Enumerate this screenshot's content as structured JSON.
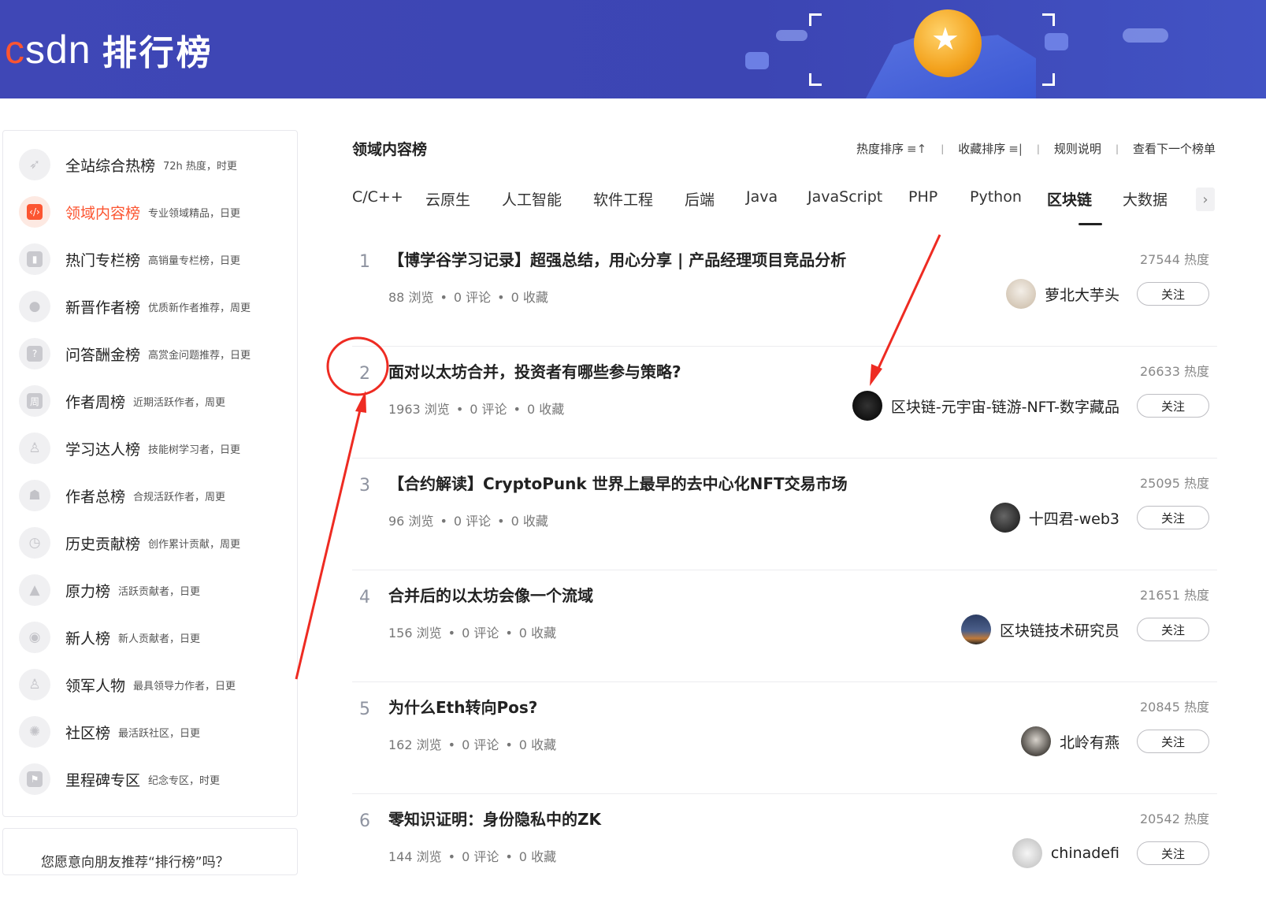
{
  "brand": {
    "logo_text": "csdn",
    "title": "排行榜"
  },
  "sidebar": {
    "items": [
      {
        "name": "全站综合热榜",
        "desc": "72h 热度，时更",
        "icon": "rocket-icon",
        "active": false
      },
      {
        "name": "领域内容榜",
        "desc": "专业领域精品，日更",
        "icon": "code-icon",
        "active": true
      },
      {
        "name": "热门专栏榜",
        "desc": "高销量专栏榜，日更",
        "icon": "bookmark-icon",
        "active": false
      },
      {
        "name": "新晋作者榜",
        "desc": "优质新作者推荐，周更",
        "icon": "user-icon",
        "active": false
      },
      {
        "name": "问答酬金榜",
        "desc": "高赏金问题推荐，日更",
        "icon": "question-icon",
        "active": false
      },
      {
        "name": "作者周榜",
        "desc": "近期活跃作者，周更",
        "icon": "week-icon",
        "active": false
      },
      {
        "name": "学习达人榜",
        "desc": "技能树学习者，日更",
        "icon": "medal-icon",
        "active": false
      },
      {
        "name": "作者总榜",
        "desc": "合规活跃作者，周更",
        "icon": "group-icon",
        "active": false
      },
      {
        "name": "历史贡献榜",
        "desc": "创作累计贡献，周更",
        "icon": "clock-icon",
        "active": false
      },
      {
        "name": "原力榜",
        "desc": "活跃贡献者，日更",
        "icon": "hand-icon",
        "active": false
      },
      {
        "name": "新人榜",
        "desc": "新人贡献者，日更",
        "icon": "chat-icon",
        "active": false
      },
      {
        "name": "领军人物",
        "desc": "最具领导力作者，日更",
        "icon": "medal-icon",
        "active": false
      },
      {
        "name": "社区榜",
        "desc": "最活跃社区，日更",
        "icon": "community-icon",
        "active": false
      },
      {
        "name": "里程碑专区",
        "desc": "纪念专区，时更",
        "icon": "flag-icon",
        "active": false
      }
    ],
    "bottom_text": "您愿意向朋友推荐“排行榜”吗？"
  },
  "main": {
    "title": "领域内容榜",
    "sort": {
      "heat": "热度排序",
      "collect": "收藏排序",
      "rules": "规则说明",
      "next": "查看下一个榜单"
    },
    "tabs": [
      "C/C++",
      "云原生",
      "人工智能",
      "软件工程",
      "后端",
      "Java",
      "JavaScript",
      "PHP",
      "Python",
      "区块链",
      "大数据"
    ],
    "active_tab": "区块链",
    "follow_label": "关注",
    "items": [
      {
        "rank": "1",
        "title": "【博学谷学习记录】超强总结，用心分享 | 产品经理项目竞品分析",
        "heat": "27544 热度",
        "views": "88 浏览",
        "comments": "0 评论",
        "collects": "0 收藏",
        "author": "萝北大芋头",
        "avatar_color": "#d9cfc2"
      },
      {
        "rank": "2",
        "title": "面对以太坊合并，投资者有哪些参与策略?",
        "heat": "26633 热度",
        "views": "1963 浏览",
        "comments": "0 评论",
        "collects": "0 收藏",
        "author": "区块链-元宇宙-链游-NFT-数字藏品",
        "avatar_color": "#111111"
      },
      {
        "rank": "3",
        "title": "【合约解读】CryptoPunk 世界上最早的去中心化NFT交易市场",
        "heat": "25095 热度",
        "views": "96 浏览",
        "comments": "0 评论",
        "collects": "0 收藏",
        "author": "十四君-web3",
        "avatar_color": "#2a2a2a"
      },
      {
        "rank": "4",
        "title": "合并后的以太坊会像一个流域",
        "heat": "21651 热度",
        "views": "156 浏览",
        "comments": "0 评论",
        "collects": "0 收藏",
        "author": "区块链技术研究员",
        "avatar_color": "#3b4a6b"
      },
      {
        "rank": "5",
        "title": "为什么Eth转向Pos?",
        "heat": "20845 热度",
        "views": "162 浏览",
        "comments": "0 评论",
        "collects": "0 收藏",
        "author": "北岭有燕",
        "avatar_color": "#5a5550"
      },
      {
        "rank": "6",
        "title": "零知识证明：身份隐私中的ZK",
        "heat": "20542 热度",
        "views": "144 浏览",
        "comments": "0 评论",
        "collects": "0 收藏",
        "author": "chinadefi",
        "avatar_color": "#cccccc"
      }
    ]
  },
  "colors": {
    "accent": "#fc5531",
    "banner": "#3f47b6",
    "annotation": "#ee2b22"
  }
}
